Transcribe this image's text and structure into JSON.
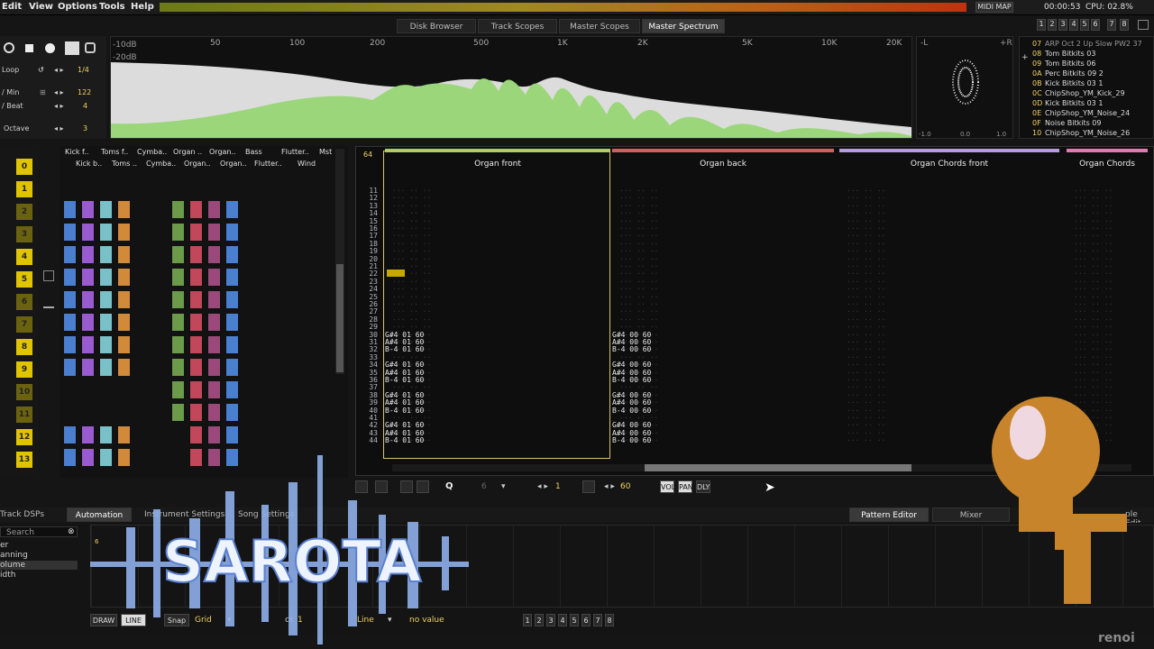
{
  "menu": [
    "Edit",
    "View",
    "Options",
    "Tools",
    "Help"
  ],
  "status": {
    "midi_map": "MIDI MAP",
    "time": "00:00:53",
    "cpu": "CPU: 02.8%"
  },
  "track_sel": [
    "1",
    "2",
    "3",
    "4",
    "5",
    "6",
    "7",
    "8"
  ],
  "top_tabs": [
    "Disk Browser",
    "Track Scopes",
    "Master Scopes",
    "Master Spectrum"
  ],
  "transport": {
    "loop_label": "Loop",
    "loop_value": "1/4",
    "bpm_label": "/ Min",
    "bpm_value": "122",
    "lpb_label": "/ Beat",
    "lpb_value": "4",
    "octave_label": "Octave",
    "octave_value": "3"
  },
  "spectrum": {
    "db_top": "-10dB",
    "db_mid": "-20dB",
    "freqs": [
      "50",
      "100",
      "200",
      "500",
      "1K",
      "2K",
      "5K",
      "10K",
      "20K"
    ],
    "scope_l": "-L",
    "scope_r": "+R",
    "scope_ticks": [
      "-1.0",
      "0.0",
      "1.0"
    ]
  },
  "instruments": [
    {
      "n": "07",
      "name": "ARP Oct 2 Up Slow PW2 37"
    },
    {
      "n": "08",
      "name": "Tom Bitkits 03"
    },
    {
      "n": "09",
      "name": "Tom Bitkits 06"
    },
    {
      "n": "0A",
      "name": "Perc Bitkits 09 2"
    },
    {
      "n": "0B",
      "name": "Kick Bitkits 03 1"
    },
    {
      "n": "0C",
      "name": "ChipShop_YM_Kick_29"
    },
    {
      "n": "0D",
      "name": "Kick Bitkits 03 1"
    },
    {
      "n": "0E",
      "name": "ChipShop_YM_Noise_24"
    },
    {
      "n": "0F",
      "name": "Noise Bitkits 09"
    },
    {
      "n": "10",
      "name": "ChipShop_YM_Noise_26"
    }
  ],
  "sequence": [
    "0",
    "1",
    "2",
    "3",
    "4",
    "5",
    "6",
    "7",
    "8",
    "9",
    "10",
    "11",
    "12",
    "13"
  ],
  "matrix_headers_top": [
    "Kick f..",
    "Toms f..",
    "Cymba..",
    "Organ ..",
    "Organ..",
    "Bass",
    "Flutter..",
    "Mst"
  ],
  "matrix_headers_bottom": [
    "Kick b..",
    "Toms ..",
    "Cymba..",
    "Organ..",
    "Organ..",
    "Flutter..",
    "Wind"
  ],
  "pattern": {
    "lines": "64",
    "tracks": [
      "Organ front",
      "Organ back",
      "Organ Chords front",
      "Organ Chords"
    ],
    "play": "PLAY",
    "rows": [
      "11",
      "12",
      "13",
      "14",
      "15",
      "16",
      "17",
      "18",
      "19",
      "20",
      "21",
      "22",
      "23",
      "24",
      "25",
      "26",
      "27",
      "28",
      "29",
      "30",
      "31",
      "32",
      "33",
      "34",
      "35",
      "36",
      "37",
      "38",
      "39",
      "40",
      "41",
      "42",
      "43",
      "44"
    ],
    "notes_t1": [
      "G#4 01 60",
      "A#4 01 60",
      "B-4 01 60"
    ],
    "notes_t2": [
      "G#4 00 60",
      "A#4 00 60",
      "B-4 00 60"
    ]
  },
  "pattern_toolbar": {
    "q": "Q",
    "step": "6",
    "edit_step": "1",
    "value": "60",
    "vol": "VOL",
    "pan": "PAN",
    "dly": "DLY"
  },
  "bottom_tabs": [
    "Track DSPs",
    "Automation",
    "Instrument Settings",
    "Song Settings",
    "Pattern Editor",
    "Mixer",
    "ple Edit"
  ],
  "automation": {
    "search": "Search",
    "params": [
      "er",
      "anning",
      "olume",
      "idth"
    ],
    "first_mark": "6"
  },
  "bottom_bar": {
    "draw": "DRAW",
    "line": "LINE",
    "snap": "Snap",
    "grid": "Grid",
    "lock": "ck",
    "lock_val": "1",
    "interp": "Line",
    "value": "no value",
    "pages": [
      "1",
      "2",
      "3",
      "4",
      "5",
      "6",
      "7",
      "8"
    ]
  },
  "overlay": {
    "logo": "SAROTA",
    "watermark": "renoi"
  }
}
